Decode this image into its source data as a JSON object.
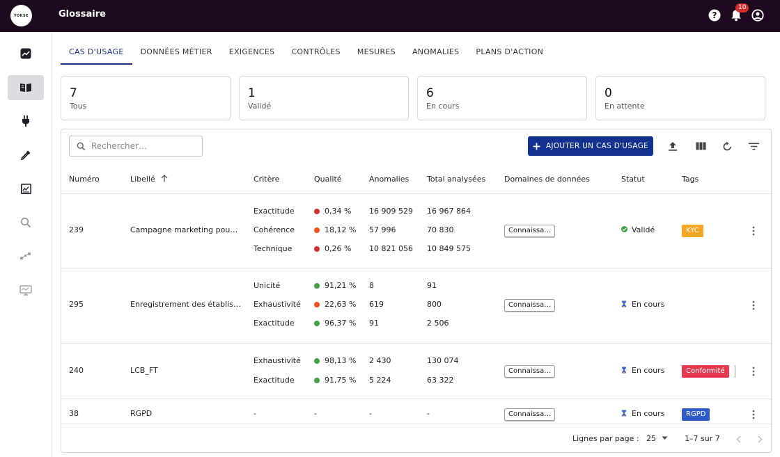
{
  "app": {
    "logo_text": "YOKSE",
    "title": "Glossaire",
    "notifications_count": "10"
  },
  "tabs": [
    "CAS D'USAGE",
    "DONNÉES MÉTIER",
    "EXIGENCES",
    "CONTRÔLES",
    "MESURES",
    "ANOMALIES",
    "PLANS D'ACTION"
  ],
  "summary": [
    {
      "value": "7",
      "label": "Tous"
    },
    {
      "value": "1",
      "label": "Validé"
    },
    {
      "value": "6",
      "label": "En cours"
    },
    {
      "value": "0",
      "label": "En attente"
    }
  ],
  "search": {
    "placeholder": "Rechercher…"
  },
  "toolbar": {
    "add_label": "AJOUTER UN CAS D'USAGE"
  },
  "columns": {
    "numero": "Numéro",
    "libelle": "Libellé",
    "critere": "Critère",
    "qualite": "Qualité",
    "anomalies": "Anomalies",
    "total": "Total analysées",
    "domaines": "Domaines de données",
    "statut": "Statut",
    "tags": "Tags"
  },
  "rows": [
    {
      "numero": "239",
      "libelle": "Campagne marketing pou…",
      "criteria": [
        {
          "critere": "Exactitude",
          "qualite": "0,34 %",
          "anomalies": "16 909 529",
          "total": "16 967 864"
        },
        {
          "critere": "Cohérence",
          "qualite": "18,12 %",
          "anomalies": "57 996",
          "total": "70 830"
        },
        {
          "critere": "Technique",
          "qualite": "0,26 %",
          "anomalies": "10 821 056",
          "total": "10 849 575"
        }
      ],
      "domaine": "Connaissa…",
      "statut": "Validé",
      "tag": "KYC"
    },
    {
      "numero": "295",
      "libelle": "Enregistrement des établis…",
      "criteria": [
        {
          "critere": "Unicité",
          "qualite": "91,21 %",
          "anomalies": "8",
          "total": "91"
        },
        {
          "critere": "Exhaustivité",
          "qualite": "22,63 %",
          "anomalies": "619",
          "total": "800"
        },
        {
          "critere": "Exactitude",
          "qualite": "96,37 %",
          "anomalies": "91",
          "total": "2 506"
        }
      ],
      "domaine": "Connaissa…",
      "statut": "En cours",
      "tag": ""
    },
    {
      "numero": "240",
      "libelle": "LCB_FT",
      "criteria": [
        {
          "critere": "Exhaustivité",
          "qualite": "98,13 %",
          "anomalies": "2 430",
          "total": "130 074"
        },
        {
          "critere": "Exactitude",
          "qualite": "91,75 %",
          "anomalies": "5 224",
          "total": "63 322"
        }
      ],
      "domaine": "Connaissa…",
      "statut": "En cours",
      "tag": "Conformité"
    },
    {
      "numero": "38",
      "libelle": "RGPD",
      "criteria": [
        {
          "critere": "-",
          "qualite": "-",
          "anomalies": "-",
          "total": "-"
        }
      ],
      "domaine": "Connaissa…",
      "statut": "En cours",
      "tag": "RGPD"
    }
  ],
  "pagination": {
    "rows_label": "Lignes par page :",
    "rows_value": "25",
    "range": "1–7 sur 7"
  },
  "colors": {
    "accent": "#13318f",
    "red": "#d32f2f",
    "orange": "#f4511e",
    "green": "#43a047",
    "tag_kyc": "#f5a623",
    "tag_conformite": "#e53950",
    "tag_rgpd": "#2f5cc9"
  }
}
